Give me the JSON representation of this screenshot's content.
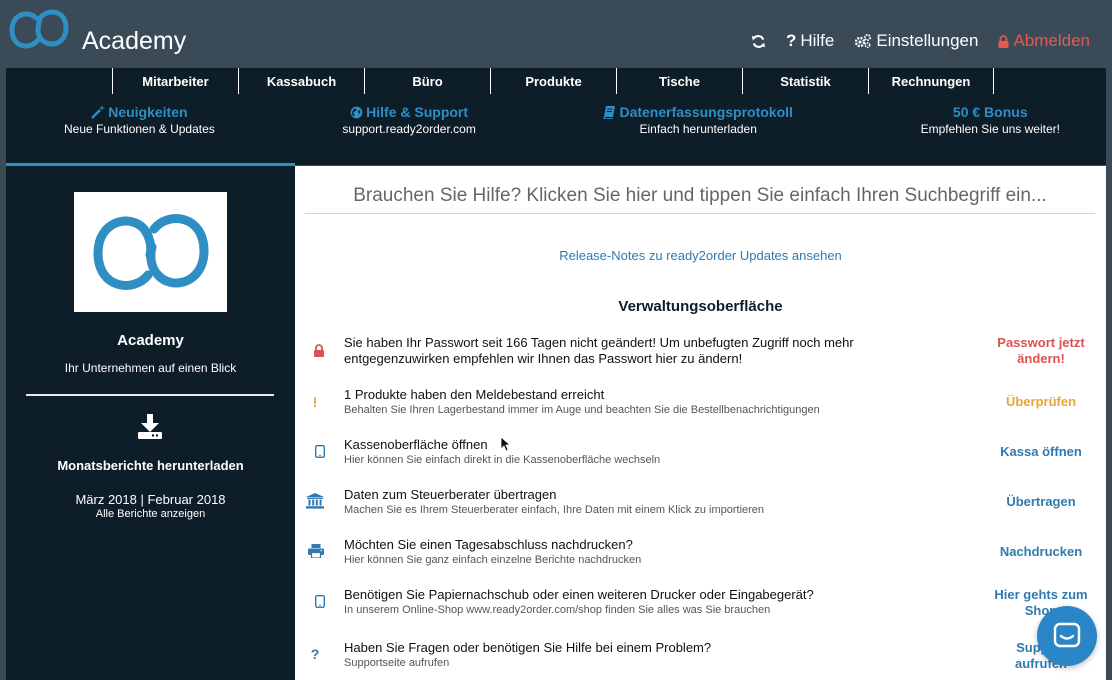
{
  "app": {
    "brand": "Academy"
  },
  "header": {
    "actions": [
      {
        "label": "",
        "icon": "refresh-icon"
      },
      {
        "label": "Hilfe",
        "icon": "question-icon"
      },
      {
        "label": "Einstellungen",
        "icon": "gears-icon"
      },
      {
        "label": "Abmelden",
        "icon": "lock-icon"
      }
    ]
  },
  "nav": {
    "items": [
      "Mitarbeiter",
      "Kassabuch",
      "Büro",
      "Produkte",
      "Tische",
      "Statistik",
      "Rechnungen"
    ]
  },
  "promos": [
    {
      "title": "Neuigkeiten",
      "subtitle": "Neue Funktionen & Updates",
      "icon": "magic-wand-icon"
    },
    {
      "title": "Hilfe & Support",
      "subtitle": "support.ready2order.com",
      "icon": "globe-icon"
    },
    {
      "title": "Datenerfassungsprotokoll",
      "subtitle": "Einfach herunterladen",
      "icon": "book-icon"
    },
    {
      "title": "50 € Bonus",
      "subtitle": "Empfehlen Sie uns weiter!",
      "icon": ""
    }
  ],
  "sidebar": {
    "company_name": "Academy",
    "company_sub": "Ihr Unternehmen auf einen Blick",
    "reports_title": "Monatsberichte herunterladen",
    "months": [
      "März 2018",
      "Februar 2018"
    ],
    "separator": " | ",
    "all_reports": "Alle Berichte anzeigen"
  },
  "main": {
    "search_placeholder": "Brauchen Sie Hilfe? Klicken Sie hier und tippen Sie einfach Ihren Suchbegriff ein...",
    "release_link": "Release-Notes zu ready2order Updates ansehen",
    "section_title": "Verwaltungsoberfläche",
    "tasks": [
      {
        "icon": "lock-icon",
        "title": "Sie haben Ihr Passwort seit 166 Tagen nicht geändert! Um unbefugten Zugriff noch mehr entgegenzuwirken empfehlen wir Ihnen das Passwort hier zu ändern!",
        "subtitle": "",
        "action": "Passwort jetzt\nändern!",
        "color": "#d9534f"
      },
      {
        "icon": "exclamation-icon",
        "title": "1 Produkte haben den Meldebestand erreicht",
        "subtitle": "Behalten Sie Ihren Lagerbestand immer im Auge und beachten Sie die Bestellbenachrichtigungen",
        "action": "Überprüfen",
        "color": "#e8a53a"
      },
      {
        "icon": "tablet-icon",
        "title": "Kassenoberfläche öffnen",
        "subtitle": "Hier können Sie einfach direkt in die Kassenoberfläche wechseln",
        "action": "Kassa öffnen",
        "color": "#2f7bb0"
      },
      {
        "icon": "bank-icon",
        "title": "Daten zum Steuerberater übertragen",
        "subtitle": "Machen Sie es Ihrem Steuerberater einfach, Ihre Daten mit einem Klick zu importieren",
        "action": "Übertragen",
        "color": "#2f7bb0"
      },
      {
        "icon": "printer-icon",
        "title": "Möchten Sie einen Tagesabschluss nachdrucken?",
        "subtitle": "Hier können Sie ganz einfach einzelne Berichte nachdrucken",
        "action": "Nachdrucken",
        "color": "#2f7bb0"
      },
      {
        "icon": "tablet-icon",
        "title": "Benötigen Sie Papiernachschub oder einen weiteren Drucker oder Eingabegerät?",
        "subtitle": "In unserem Online-Shop www.ready2order.com/shop finden Sie alles was Sie brauchen",
        "action": "Hier gehts zum\nShop",
        "color": "#2f7bb0"
      },
      {
        "icon": "question-icon",
        "title": "Haben Sie Fragen oder benötigen Sie Hilfe bei einem Problem?",
        "subtitle": "Supportseite aufrufen",
        "action": "Support\naufrufen",
        "color": "#2f7bb0"
      }
    ]
  },
  "colors": {
    "accent": "#2f8ec4",
    "dark": "#0e1e28",
    "header": "#3a4b57",
    "danger": "#d9534f",
    "warning": "#e8a53a"
  }
}
